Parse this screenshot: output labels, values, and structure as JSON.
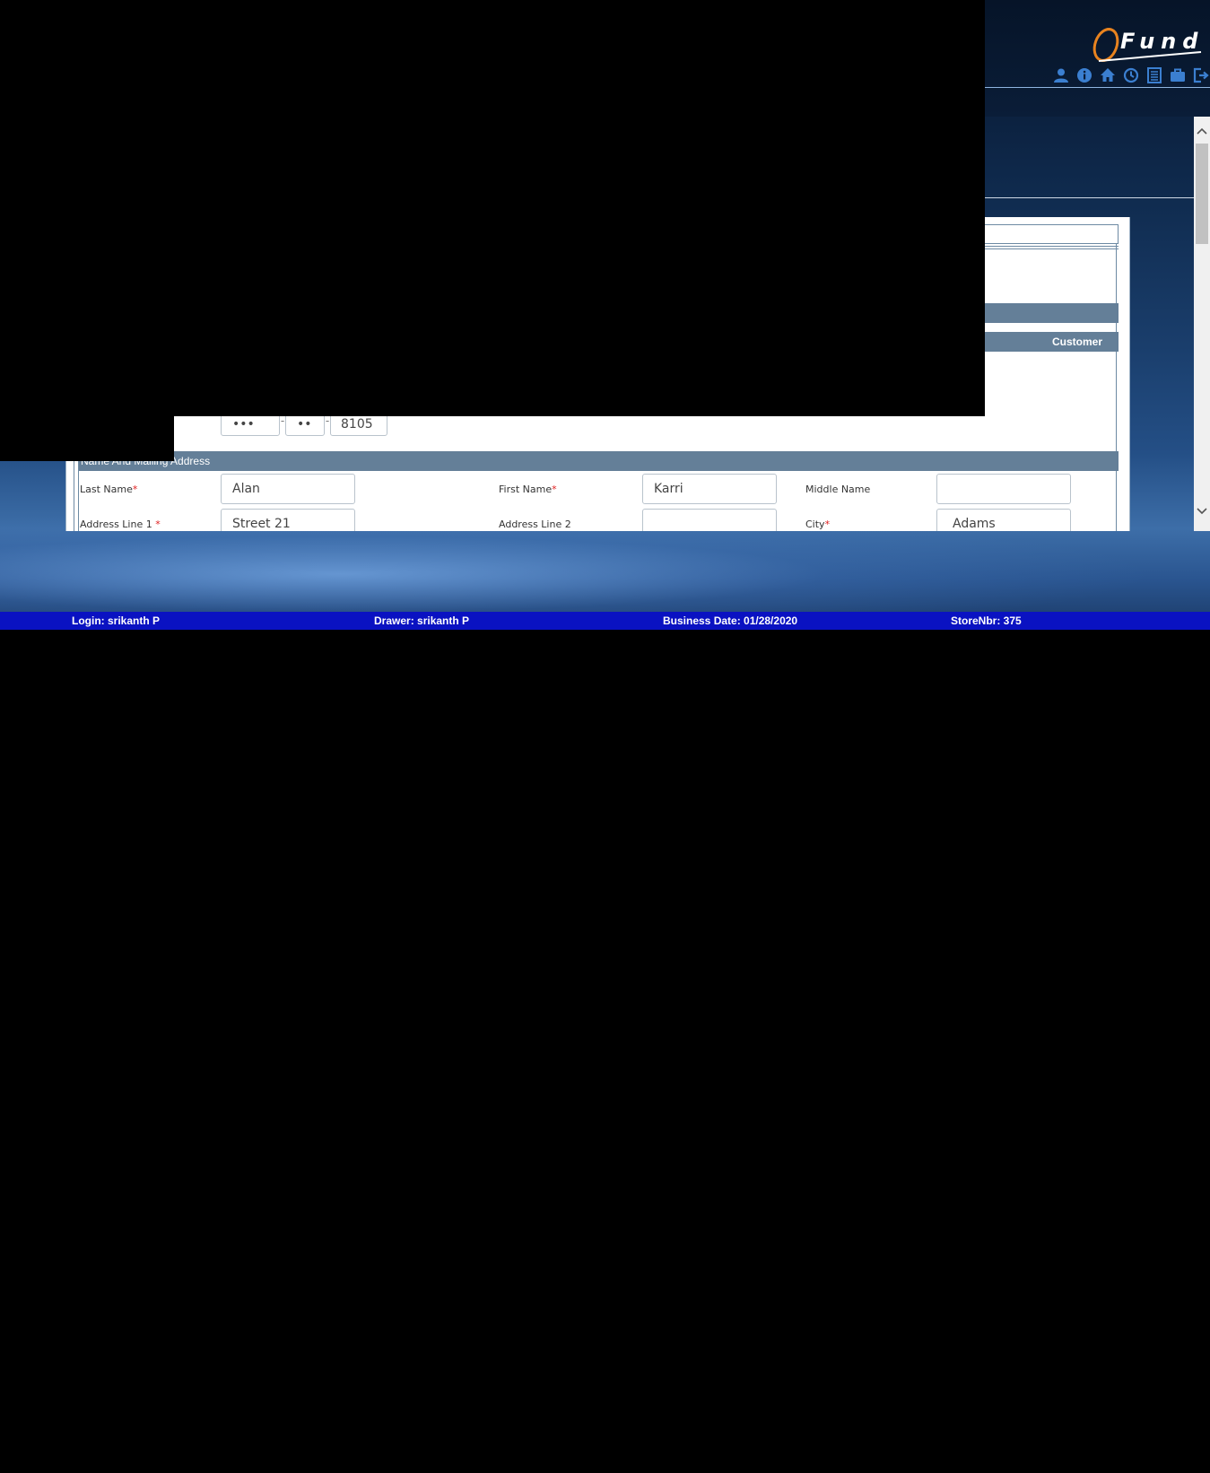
{
  "header": {
    "logo_text": "Fund",
    "toolbar": [
      {
        "icon": "user-icon"
      },
      {
        "icon": "info-icon"
      },
      {
        "icon": "home-icon"
      },
      {
        "icon": "clock-icon"
      },
      {
        "icon": "list-icon"
      },
      {
        "icon": "briefcase-icon"
      },
      {
        "icon": "logout-icon"
      }
    ]
  },
  "customer": {
    "bar_label": "Customer Nbr:"
  },
  "ssn": {
    "part1": "•••",
    "part2": "••",
    "part3": "8105"
  },
  "name_section": {
    "title": "Name And Mailing Address",
    "last_name_label": "Last Name",
    "last_name": "Alan",
    "first_name_label": "First Name",
    "first_name": "Karri",
    "middle_name_label": "Middle Name",
    "middle_name": "",
    "address1_label": "Address Line 1 ",
    "address1": "Street 21",
    "address2_label": "Address Line 2",
    "address2": "",
    "city_label": "City",
    "city": "Adams",
    "required_mark": "*"
  },
  "statusbar": {
    "login": "Login: srikanth P",
    "drawer": "Drawer: srikanth P",
    "business_date": "Business Date: 01/28/2020",
    "store": "StoreNbr: 375"
  },
  "colors": {
    "accent": "#3b7fd0",
    "section_bar": "#647f98",
    "statusbar": "#0a12c2",
    "logo_orange": "#e8831f",
    "required": "#e02020"
  }
}
